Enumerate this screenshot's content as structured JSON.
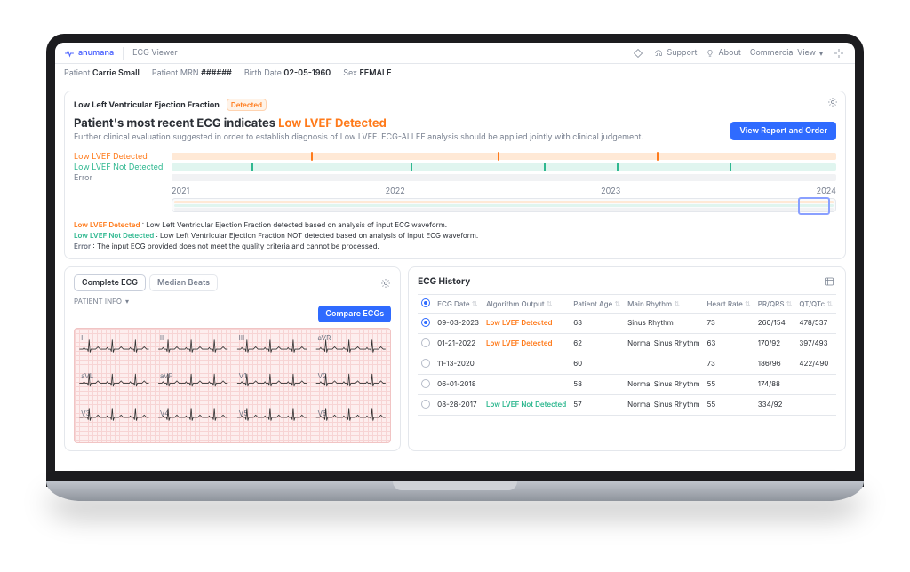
{
  "brand": "anumana",
  "app_title": "ECG Viewer",
  "header": {
    "support": "Support",
    "about": "About",
    "view_mode": "Commercial View"
  },
  "patient": {
    "label_name": "Patient",
    "name": "Carrie Small",
    "label_mrn": "Patient MRN",
    "mrn": "######",
    "label_dob": "Birth Date",
    "dob": "02-05-1960",
    "label_sex": "Sex",
    "sex": "FEMALE"
  },
  "diagnosis": {
    "tab": "Low Left Ventricular Ejection Fraction",
    "chip": "Detected",
    "headline_pre": "Patient's most recent ECG indicates ",
    "headline_accent": "Low LVEF Detected",
    "sub": "Further clinical evaluation suggested in order to establish diagnosis of Low LVEF. ECG-AI LEF analysis should be applied jointly with clinical judgement.",
    "view_report": "View Report and Order"
  },
  "timeline": {
    "rows": [
      {
        "label": "Low LVEF Detected",
        "kind": "orange",
        "ticks": [
          21,
          49,
          73
        ]
      },
      {
        "label": "Low LVEF Not Detected",
        "kind": "green",
        "ticks": [
          12,
          36,
          56,
          67,
          84
        ]
      },
      {
        "label": "Error",
        "kind": "err",
        "ticks": []
      }
    ],
    "years": [
      "2021",
      "2022",
      "2023",
      "2024"
    ]
  },
  "legend": {
    "o_title": "Low LVEF Detected",
    "o_text": " : Low Left Ventricular Ejection Fraction detected based on analysis of input ECG waveform.",
    "g_title": "Low LVEF Not Detected",
    "g_text": " : Low Left Ventricular Ejection Fraction NOT detected based on analysis of input ECG waveform.",
    "e_title": "Error",
    "e_text": " : The input ECG provided does not meet the quality criteria and cannot be processed."
  },
  "ecg_panel": {
    "tab_complete": "Complete ECG",
    "tab_median": "Median Beats",
    "patient_info": "PATIENT INFO",
    "compare": "Compare ECGs",
    "leads": [
      "I",
      "II",
      "III",
      "aVR",
      "aVL",
      "aVF",
      "V1",
      "V2",
      "V3",
      "V4",
      "V5",
      "V6"
    ]
  },
  "history": {
    "title": "ECG History",
    "cols": [
      "",
      "ECG Date",
      "Algorithm Output",
      "Patient Age",
      "Main Rhythm",
      "Heart Rate",
      "PR/QRS",
      "QT/QTc"
    ],
    "rows": [
      {
        "sel": true,
        "date": "09-03-2023",
        "out": "Low LVEF Detected",
        "out_kind": "o",
        "age": "63",
        "rhythm": "Sinus Rhythm",
        "hr": "73",
        "prqrs": "260/154",
        "qt": "478/537"
      },
      {
        "sel": false,
        "date": "01-21-2022",
        "out": "Low LVEF Detected",
        "out_kind": "o",
        "age": "62",
        "rhythm": "Normal Sinus Rhythm",
        "hr": "63",
        "prqrs": "170/92",
        "qt": "397/493"
      },
      {
        "sel": false,
        "date": "11-13-2020",
        "out": "",
        "out_kind": "",
        "age": "60",
        "rhythm": "",
        "hr": "73",
        "prqrs": "186/96",
        "qt": "422/490"
      },
      {
        "sel": false,
        "date": "06-01-2018",
        "out": "",
        "out_kind": "",
        "age": "58",
        "rhythm": "Normal Sinus Rhythm",
        "hr": "55",
        "prqrs": "174/88",
        "qt": ""
      },
      {
        "sel": false,
        "date": "08-28-2017",
        "out": "Low LVEF Not Detected",
        "out_kind": "g",
        "age": "57",
        "rhythm": "Normal Sinus Rhythm",
        "hr": "55",
        "prqrs": "334/92",
        "qt": ""
      }
    ]
  },
  "chart_data": {
    "type": "table",
    "title": "ECG History",
    "columns": [
      "ECG Date",
      "Algorithm Output",
      "Patient Age",
      "Main Rhythm",
      "Heart Rate",
      "PR/QRS",
      "QT/QTc"
    ],
    "rows": [
      [
        "09-03-2023",
        "Low LVEF Detected",
        63,
        "Sinus Rhythm",
        73,
        "260/154",
        "478/537"
      ],
      [
        "01-21-2022",
        "Low LVEF Detected",
        62,
        "Normal Sinus Rhythm",
        63,
        "170/92",
        "397/493"
      ],
      [
        "11-13-2020",
        null,
        60,
        null,
        73,
        "186/96",
        "422/490"
      ],
      [
        "06-01-2018",
        null,
        58,
        "Normal Sinus Rhythm",
        55,
        "174/88",
        null
      ],
      [
        "08-28-2017",
        "Low LVEF Not Detected",
        57,
        "Normal Sinus Rhythm",
        55,
        "334/92",
        null
      ]
    ]
  }
}
